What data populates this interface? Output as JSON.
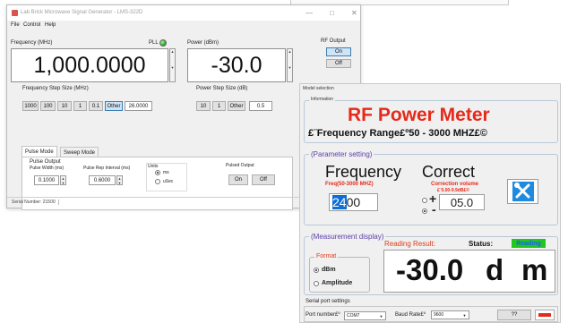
{
  "lab_window": {
    "title": "Lab Brick Microwave Signal Generator - LMS-322D",
    "controls": {
      "minimize": "—",
      "maximize": "□",
      "close": "✕"
    },
    "menu": [
      "File",
      "Control",
      "Help"
    ],
    "frequency": {
      "label": "Frequency (MHz)",
      "value": "1,000.0000",
      "pll_label": "PLL"
    },
    "power": {
      "label": "Power (dBm)",
      "value": "-30.0"
    },
    "rf_output": {
      "label": "RF Output",
      "on": "On",
      "off": "Off"
    },
    "freq_step": {
      "label": "Frequency Step Size (MHz)",
      "buttons": [
        "1000",
        "100",
        "10",
        "1",
        "0.1",
        "Other"
      ],
      "value": "26.0000"
    },
    "power_step": {
      "label": "Power Step Size (dB)",
      "buttons": [
        "10",
        "1",
        "Other"
      ],
      "value": "0.5"
    },
    "tabs": [
      "Pulse Mode",
      "Sweep Mode"
    ],
    "pulse": {
      "group_label": "Pulse Output",
      "width_label": "Pulse Width (ms)",
      "width_value": "0.1000",
      "interval_label": "Pulse Rep Interval (ms)",
      "interval_value": "0.6000",
      "units_label": "Units",
      "units": [
        "ms",
        "uSec"
      ],
      "pulsed_label": "Pulsed Output",
      "on": "On",
      "off": "Off"
    },
    "status": "Serial Number: 21500"
  },
  "model_window": {
    "title": "Model selection",
    "info_label": "Information",
    "heading": "RF Power Meter",
    "subheading": "£¨Frequency Range£º50 - 3000 MHZ£©",
    "param_label": "(Parameter setting)",
    "frequency": {
      "label": "Frequency",
      "sublabel": "Freq(50-3000 MHZ)",
      "value_sel": "24",
      "value_rest": "00"
    },
    "correct": {
      "label": "Correct",
      "sublabel": "Correction volume",
      "sublabel2": "£¨0.00-9.9dB£©",
      "value": "05.0",
      "plus": "+",
      "minus": "-"
    },
    "measure_label": "(Measurement display)",
    "reading_result_label": "Reading Result:",
    "status_label": "Status:",
    "status_value": "Reading",
    "format": {
      "label": "Format",
      "options": [
        "dBm",
        "Amplitude"
      ]
    },
    "reading_value": "-30.0",
    "reading_unit_d": "d",
    "reading_unit_m": "m",
    "serial": {
      "label": "Serial port settings",
      "port_label": "Port number£º",
      "port_value": "COM7",
      "baud_label": "Baud Rate£º",
      "baud_value": "9600",
      "help_button": "??"
    }
  },
  "colors": {
    "accent_red": "#e52a1a",
    "group_purple": "#5b3fa8",
    "status_green": "#22c71d",
    "status_blue": "#1f5cff"
  }
}
